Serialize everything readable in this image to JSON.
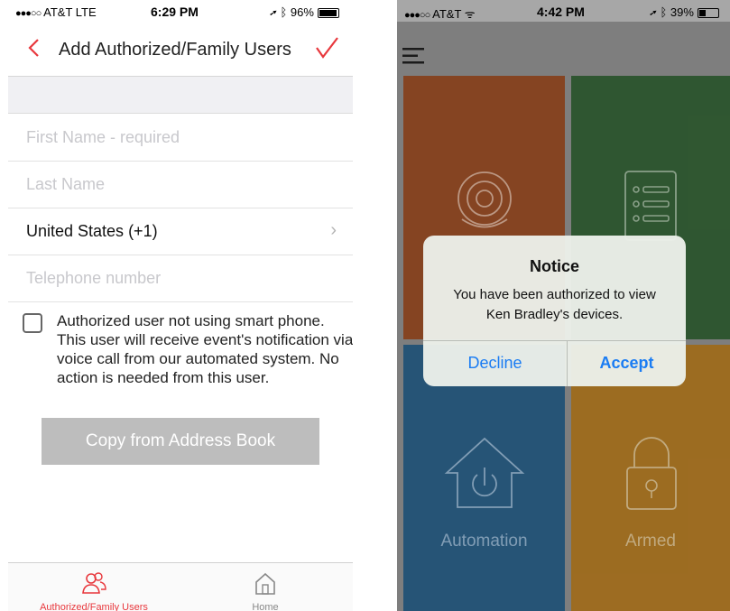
{
  "left": {
    "status": {
      "carrier": "AT&T  LTE",
      "time": "6:29 PM",
      "battery": "96%",
      "battery_level": 0.96
    },
    "nav": {
      "title": "Add Authorized/Family Users"
    },
    "fields": {
      "first_name_placeholder": "First Name - required",
      "last_name_placeholder": "Last Name",
      "country_value": "United States (+1)",
      "telephone_placeholder": "Telephone number"
    },
    "checkbox_text": "Authorized user not using smart phone. This user will receive event's notification via voice call from our automated system. No action is needed from this user.",
    "copy_button": "Copy from Address Book",
    "tabs": [
      {
        "label": "Authorized/Family Users",
        "icon": "users-icon",
        "active": true
      },
      {
        "label": "Home",
        "icon": "home-icon",
        "active": false
      }
    ],
    "colors": {
      "accent": "#e8383d"
    }
  },
  "right": {
    "status": {
      "carrier": "AT&T",
      "time": "4:42 PM",
      "battery": "39%",
      "battery_level": 0.39
    },
    "tiles": [
      {
        "label": "",
        "icon": "camera-icon",
        "color": "#a3542a"
      },
      {
        "label": "",
        "icon": "sensor-list-icon",
        "color": "#3a6a3c"
      },
      {
        "label": "Automation",
        "icon": "house-power-icon",
        "color": "#2f6790"
      },
      {
        "label": "Armed",
        "icon": "lock-icon",
        "color": "#bf8429"
      }
    ],
    "dialog": {
      "title": "Notice",
      "message": "You have been authorized to view Ken Bradley's devices.",
      "decline": "Decline",
      "accept": "Accept"
    }
  }
}
